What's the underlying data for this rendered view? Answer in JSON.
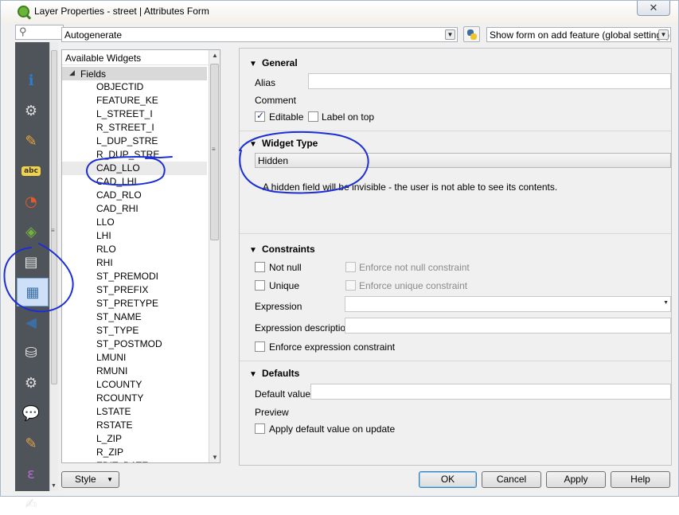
{
  "window": {
    "title": "Layer Properties - street | Attributes Form",
    "close_label": "✕"
  },
  "toolbar": {
    "layout_value": "Autogenerate",
    "show_form_value": "Show form on add feature (global settings)"
  },
  "sidebar": {
    "search_glyph": "⚲",
    "icons": [
      "information-icon",
      "source-settings-icon",
      "symbology-icon",
      "labels-icon",
      "diagrams-icon",
      "3d-view-icon",
      "fields-icon",
      "attributes-form-icon",
      "joins-icon",
      "auxiliary-storage-icon",
      "actions-icon",
      "display-icon",
      "rendering-icon",
      "variables-icon",
      "metadata-icon"
    ],
    "selected_index": 7
  },
  "tree": {
    "header": "Available Widgets",
    "root": "Fields",
    "items": [
      "OBJECTID",
      "FEATURE_KE",
      "L_STREET_I",
      "R_STREET_I",
      "L_DUP_STRE",
      "R_DUP_STRE",
      "CAD_LLO",
      "CAD_LHI",
      "CAD_RLO",
      "CAD_RHI",
      "LLO",
      "LHI",
      "RLO",
      "RHI",
      "ST_PREMODI",
      "ST_PREFIX",
      "ST_PRETYPE",
      "ST_NAME",
      "ST_TYPE",
      "ST_POSTMOD",
      "LMUNI",
      "RMUNI",
      "LCOUNTY",
      "RCOUNTY",
      "LSTATE",
      "RSTATE",
      "L_ZIP",
      "R_ZIP",
      "EDIT_DATE"
    ],
    "selected_item": "CAD_LLO"
  },
  "general": {
    "heading": "General",
    "alias_label": "Alias",
    "alias_value": "",
    "comment_label": "Comment",
    "editable_label": "Editable",
    "editable_checked": true,
    "label_on_top_label": "Label on top",
    "label_on_top_checked": false
  },
  "widget_type": {
    "heading": "Widget Type",
    "value": "Hidden",
    "description": "A hidden field will be invisible - the user is not able to see its contents."
  },
  "constraints": {
    "heading": "Constraints",
    "not_null_label": "Not null",
    "enforce_not_null_label": "Enforce not null constraint",
    "unique_label": "Unique",
    "enforce_unique_label": "Enforce unique constraint",
    "expression_label": "Expression",
    "expression_value": "",
    "expression_description_label": "Expression description",
    "expression_description_value": "",
    "enforce_expression_label": "Enforce expression constraint"
  },
  "defaults": {
    "heading": "Defaults",
    "default_value_label": "Default value",
    "default_value": "",
    "preview_label": "Preview",
    "apply_on_update_label": "Apply default value on update"
  },
  "buttons": {
    "style": "Style",
    "ok": "OK",
    "cancel": "Cancel",
    "apply": "Apply",
    "help": "Help"
  },
  "colors": {
    "sidebar_bg": "#4f545a",
    "annotation": "#1c2fd6",
    "selected_icon_bg": "#cde0f7"
  }
}
